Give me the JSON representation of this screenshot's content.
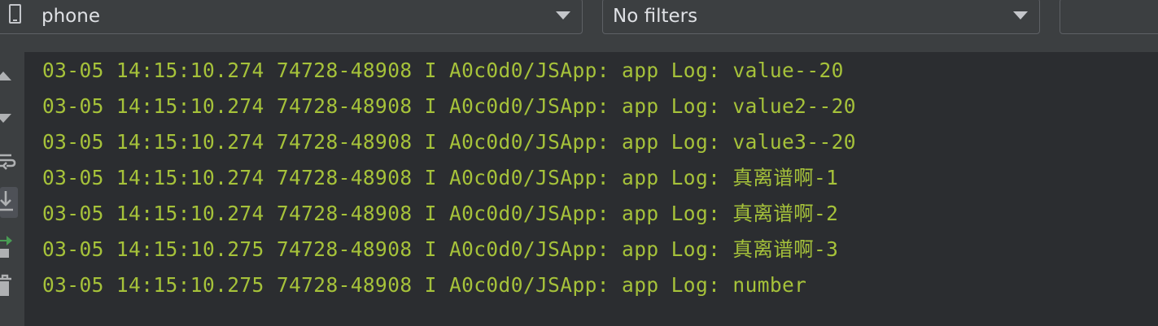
{
  "toolbar": {
    "device_label": "phone",
    "filter_label": "No filters",
    "search_value": ""
  },
  "side_toolbar": {
    "icons": [
      "scroll-up-icon",
      "scroll-down-icon",
      "soft-wrap-icon",
      "scroll-to-end-icon",
      "restart-icon",
      "trash-icon"
    ]
  },
  "log": {
    "lines": [
      "03-05 14:15:10.274 74728-48908 I A0c0d0/JSApp: app Log: value--20",
      "03-05 14:15:10.274 74728-48908 I A0c0d0/JSApp: app Log: value2--20",
      "03-05 14:15:10.274 74728-48908 I A0c0d0/JSApp: app Log: value3--20",
      "03-05 14:15:10.274 74728-48908 I A0c0d0/JSApp: app Log: 真离谱啊-1",
      "03-05 14:15:10.274 74728-48908 I A0c0d0/JSApp: app Log: 真离谱啊-2",
      "03-05 14:15:10.275 74728-48908 I A0c0d0/JSApp: app Log: 真离谱啊-3",
      "03-05 14:15:10.275 74728-48908 I A0c0d0/JSApp: app Log: number"
    ]
  },
  "colors": {
    "log_text": "#a6c23a",
    "background": "#2b2d30",
    "toolbar": "#3c3f41"
  }
}
